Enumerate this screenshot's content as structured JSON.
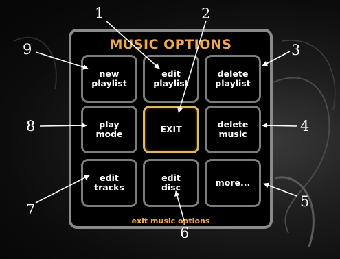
{
  "menu": {
    "title": "MUSIC OPTIONS",
    "footer": "exit music options",
    "buttons": [
      {
        "label": "new\nplaylist"
      },
      {
        "label": "edit\nplaylist"
      },
      {
        "label": "delete\nplaylist"
      },
      {
        "label": "play\nmode"
      },
      {
        "label": "EXIT"
      },
      {
        "label": "delete\nmusic"
      },
      {
        "label": "edit\ntracks"
      },
      {
        "label": "edit\ndisc"
      },
      {
        "label": "more..."
      }
    ]
  },
  "callouts": [
    "1",
    "2",
    "3",
    "4",
    "5",
    "6",
    "7",
    "8",
    "9"
  ],
  "colors": {
    "title": "#f0a850",
    "exit_border": "#e0b860",
    "button_border": "#7c7c7c"
  }
}
